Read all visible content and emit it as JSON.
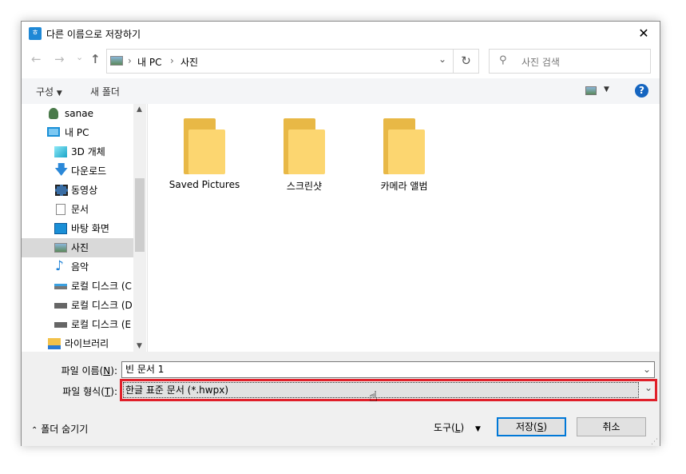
{
  "window": {
    "title": "다른 이름으로 저장하기",
    "app_icon": "ㅎ",
    "close": "✕"
  },
  "nav": {
    "back": "←",
    "forward": "→",
    "recent": "⌄",
    "up": "↑",
    "breadcrumb": [
      "내 PC",
      "사진"
    ],
    "separator": "›",
    "dropdown": "⌄",
    "refresh": "↻",
    "search_placeholder": "사진 검색"
  },
  "toolbar": {
    "organize": "구성",
    "new_folder": "새 폴더",
    "help": "?"
  },
  "sidebar": {
    "items": [
      {
        "label": "sanae",
        "icon": "user-icon"
      },
      {
        "label": "내 PC",
        "icon": "pc-icon"
      },
      {
        "label": "3D 개체",
        "icon": "cube-icon"
      },
      {
        "label": "다운로드",
        "icon": "download-icon"
      },
      {
        "label": "동영상",
        "icon": "video-icon"
      },
      {
        "label": "문서",
        "icon": "document-icon"
      },
      {
        "label": "바탕 화면",
        "icon": "desktop-icon"
      },
      {
        "label": "사진",
        "icon": "pictures-icon",
        "selected": true
      },
      {
        "label": "음악",
        "icon": "music-icon"
      },
      {
        "label": "로컬 디스크 (C",
        "icon": "drive-icon"
      },
      {
        "label": "로컬 디스크 (D",
        "icon": "drive-icon"
      },
      {
        "label": "로컬 디스크 (E",
        "icon": "drive-icon"
      },
      {
        "label": "라이브러리",
        "icon": "library-icon"
      }
    ]
  },
  "folders": [
    {
      "name": "Saved Pictures"
    },
    {
      "name": "스크린샷"
    },
    {
      "name": "카메라 앨범"
    }
  ],
  "form": {
    "filename_label": "파일 이름",
    "filename_key": "N",
    "filename_value": "빈 문서 1",
    "filetype_label": "파일 형식",
    "filetype_key": "T",
    "filetype_value": "한글 표준 문서 (*.hwpx)",
    "highlight_color": "#e0202a"
  },
  "footer": {
    "hide_folders": "폴더 숨기기",
    "tools": "도구",
    "tools_key": "L",
    "save": "저장",
    "save_key": "S",
    "cancel": "취소"
  }
}
